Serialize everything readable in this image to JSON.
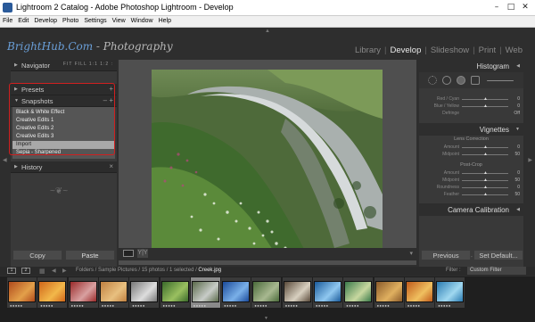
{
  "window": {
    "title": "Lightroom 2 Catalog - Adobe Photoshop Lightroom - Develop"
  },
  "menu": [
    "File",
    "Edit",
    "Develop",
    "Photo",
    "Settings",
    "View",
    "Window",
    "Help"
  ],
  "identity_plate": {
    "brand": "BrightHub.Com",
    "separator": " - ",
    "subtitle": "Photography"
  },
  "modules": {
    "items": [
      "Library",
      "Develop",
      "Slideshow",
      "Print",
      "Web"
    ],
    "active": "Develop",
    "separator": "|"
  },
  "left_panel": {
    "navigator": {
      "label": "Navigator",
      "zoom": "FIT  FILL  1:1  1:2 :"
    },
    "presets": {
      "label": "Presets"
    },
    "snapshots": {
      "label": "Snapshots",
      "items": [
        "Black & White Effect",
        "Creative Edits 1",
        "Creative Edits 2",
        "Creative Edits 3",
        "Import",
        "Sepia - Sharpened"
      ],
      "selected_index": 4
    },
    "history": {
      "label": "History"
    },
    "buttons": {
      "copy": "Copy",
      "paste": "Paste"
    }
  },
  "right_panel": {
    "histogram": {
      "label": "Histogram"
    },
    "split_toning_rows": [
      {
        "label": "Red / Cyan",
        "value": "0"
      },
      {
        "label": "Blue / Yellow",
        "value": "0"
      },
      {
        "label": "Defringe",
        "value": "Off"
      }
    ],
    "vignettes": {
      "label": "Vignettes",
      "lens_correction": "Lens Correction",
      "lens_rows": [
        {
          "label": "Amount",
          "value": "0"
        },
        {
          "label": "Midpoint",
          "value": "50"
        }
      ],
      "post_crop": "Post-Crop",
      "post_rows": [
        {
          "label": "Amount",
          "value": "0"
        },
        {
          "label": "Midpoint",
          "value": "50"
        },
        {
          "label": "Roundness",
          "value": "0"
        },
        {
          "label": "Feather",
          "value": "50"
        }
      ]
    },
    "camera_calibration": {
      "label": "Camera Calibration"
    },
    "buttons": {
      "previous": "Previous",
      "set_default": "Set Default..."
    }
  },
  "filmstrip_bar": {
    "page1": "1",
    "page2": "2",
    "path_prefix": "Folders / Sample Pictures / 15 photos / 1 selected / ",
    "filename": "Creek.jpg",
    "filter_label": "Filter :",
    "filter_value": "Custom Filter"
  },
  "filmstrip": {
    "count": 15,
    "selected_index": 6,
    "stars": "●●●●●"
  },
  "colors": {
    "app_bg": "#2e2e2e",
    "panel_bg": "#393939",
    "highlight_box": "#d01f1f",
    "identity_blue": "#6a9fd8"
  }
}
